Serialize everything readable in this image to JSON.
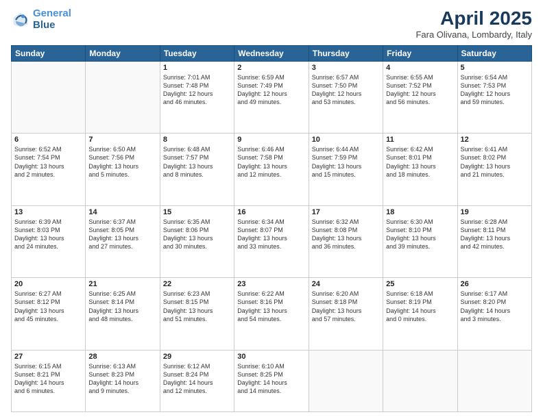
{
  "header": {
    "logo_line1": "General",
    "logo_line2": "Blue",
    "month_title": "April 2025",
    "location": "Fara Olivana, Lombardy, Italy"
  },
  "days_of_week": [
    "Sunday",
    "Monday",
    "Tuesday",
    "Wednesday",
    "Thursday",
    "Friday",
    "Saturday"
  ],
  "weeks": [
    [
      {
        "day": "",
        "info": ""
      },
      {
        "day": "",
        "info": ""
      },
      {
        "day": "1",
        "info": "Sunrise: 7:01 AM\nSunset: 7:48 PM\nDaylight: 12 hours\nand 46 minutes."
      },
      {
        "day": "2",
        "info": "Sunrise: 6:59 AM\nSunset: 7:49 PM\nDaylight: 12 hours\nand 49 minutes."
      },
      {
        "day": "3",
        "info": "Sunrise: 6:57 AM\nSunset: 7:50 PM\nDaylight: 12 hours\nand 53 minutes."
      },
      {
        "day": "4",
        "info": "Sunrise: 6:55 AM\nSunset: 7:52 PM\nDaylight: 12 hours\nand 56 minutes."
      },
      {
        "day": "5",
        "info": "Sunrise: 6:54 AM\nSunset: 7:53 PM\nDaylight: 12 hours\nand 59 minutes."
      }
    ],
    [
      {
        "day": "6",
        "info": "Sunrise: 6:52 AM\nSunset: 7:54 PM\nDaylight: 13 hours\nand 2 minutes."
      },
      {
        "day": "7",
        "info": "Sunrise: 6:50 AM\nSunset: 7:56 PM\nDaylight: 13 hours\nand 5 minutes."
      },
      {
        "day": "8",
        "info": "Sunrise: 6:48 AM\nSunset: 7:57 PM\nDaylight: 13 hours\nand 8 minutes."
      },
      {
        "day": "9",
        "info": "Sunrise: 6:46 AM\nSunset: 7:58 PM\nDaylight: 13 hours\nand 12 minutes."
      },
      {
        "day": "10",
        "info": "Sunrise: 6:44 AM\nSunset: 7:59 PM\nDaylight: 13 hours\nand 15 minutes."
      },
      {
        "day": "11",
        "info": "Sunrise: 6:42 AM\nSunset: 8:01 PM\nDaylight: 13 hours\nand 18 minutes."
      },
      {
        "day": "12",
        "info": "Sunrise: 6:41 AM\nSunset: 8:02 PM\nDaylight: 13 hours\nand 21 minutes."
      }
    ],
    [
      {
        "day": "13",
        "info": "Sunrise: 6:39 AM\nSunset: 8:03 PM\nDaylight: 13 hours\nand 24 minutes."
      },
      {
        "day": "14",
        "info": "Sunrise: 6:37 AM\nSunset: 8:05 PM\nDaylight: 13 hours\nand 27 minutes."
      },
      {
        "day": "15",
        "info": "Sunrise: 6:35 AM\nSunset: 8:06 PM\nDaylight: 13 hours\nand 30 minutes."
      },
      {
        "day": "16",
        "info": "Sunrise: 6:34 AM\nSunset: 8:07 PM\nDaylight: 13 hours\nand 33 minutes."
      },
      {
        "day": "17",
        "info": "Sunrise: 6:32 AM\nSunset: 8:08 PM\nDaylight: 13 hours\nand 36 minutes."
      },
      {
        "day": "18",
        "info": "Sunrise: 6:30 AM\nSunset: 8:10 PM\nDaylight: 13 hours\nand 39 minutes."
      },
      {
        "day": "19",
        "info": "Sunrise: 6:28 AM\nSunset: 8:11 PM\nDaylight: 13 hours\nand 42 minutes."
      }
    ],
    [
      {
        "day": "20",
        "info": "Sunrise: 6:27 AM\nSunset: 8:12 PM\nDaylight: 13 hours\nand 45 minutes."
      },
      {
        "day": "21",
        "info": "Sunrise: 6:25 AM\nSunset: 8:14 PM\nDaylight: 13 hours\nand 48 minutes."
      },
      {
        "day": "22",
        "info": "Sunrise: 6:23 AM\nSunset: 8:15 PM\nDaylight: 13 hours\nand 51 minutes."
      },
      {
        "day": "23",
        "info": "Sunrise: 6:22 AM\nSunset: 8:16 PM\nDaylight: 13 hours\nand 54 minutes."
      },
      {
        "day": "24",
        "info": "Sunrise: 6:20 AM\nSunset: 8:18 PM\nDaylight: 13 hours\nand 57 minutes."
      },
      {
        "day": "25",
        "info": "Sunrise: 6:18 AM\nSunset: 8:19 PM\nDaylight: 14 hours\nand 0 minutes."
      },
      {
        "day": "26",
        "info": "Sunrise: 6:17 AM\nSunset: 8:20 PM\nDaylight: 14 hours\nand 3 minutes."
      }
    ],
    [
      {
        "day": "27",
        "info": "Sunrise: 6:15 AM\nSunset: 8:21 PM\nDaylight: 14 hours\nand 6 minutes."
      },
      {
        "day": "28",
        "info": "Sunrise: 6:13 AM\nSunset: 8:23 PM\nDaylight: 14 hours\nand 9 minutes."
      },
      {
        "day": "29",
        "info": "Sunrise: 6:12 AM\nSunset: 8:24 PM\nDaylight: 14 hours\nand 12 minutes."
      },
      {
        "day": "30",
        "info": "Sunrise: 6:10 AM\nSunset: 8:25 PM\nDaylight: 14 hours\nand 14 minutes."
      },
      {
        "day": "",
        "info": ""
      },
      {
        "day": "",
        "info": ""
      },
      {
        "day": "",
        "info": ""
      }
    ]
  ]
}
